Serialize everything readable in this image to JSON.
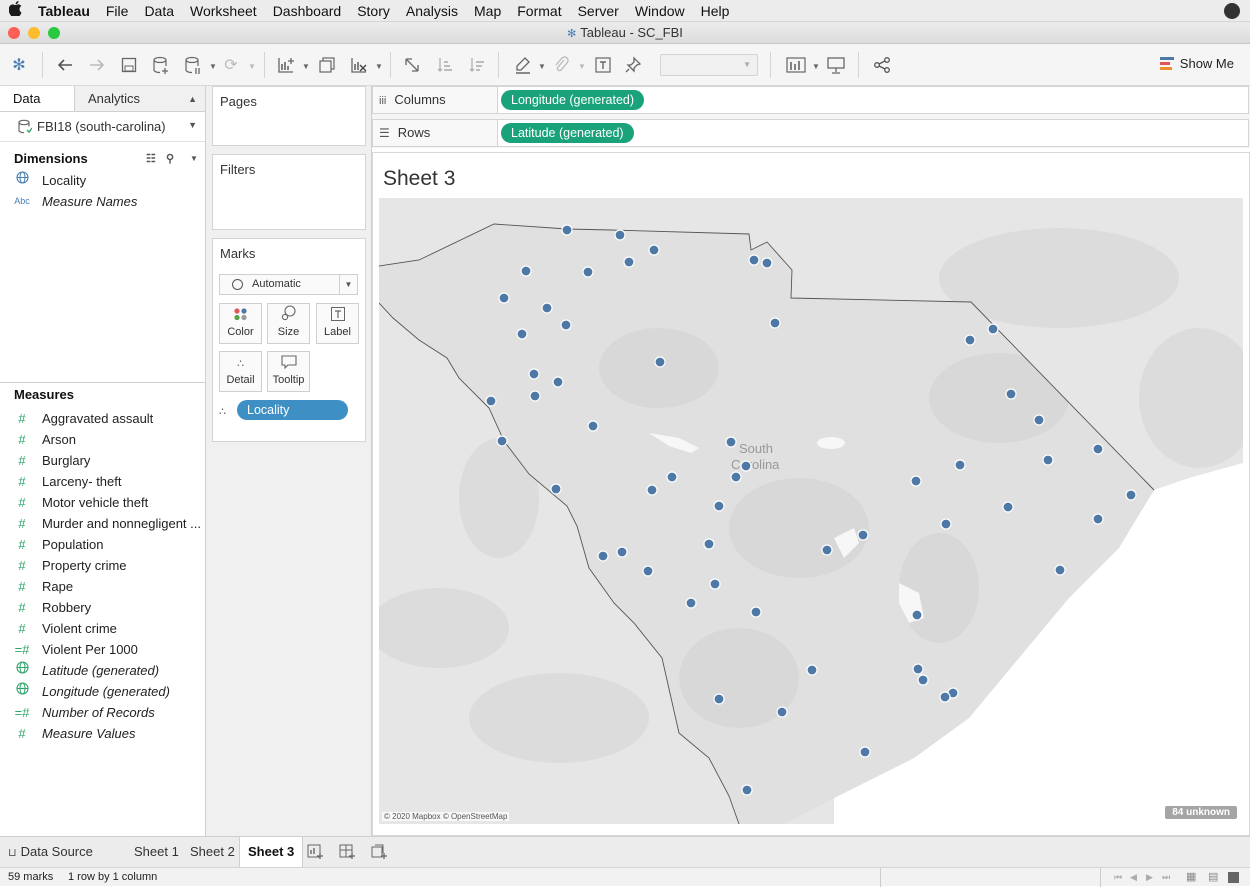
{
  "menubar": {
    "apple": "",
    "app": "Tableau",
    "items": [
      "File",
      "Data",
      "Worksheet",
      "Dashboard",
      "Story",
      "Analysis",
      "Map",
      "Format",
      "Server",
      "Window",
      "Help"
    ]
  },
  "window": {
    "title": "Tableau - SC_FBI"
  },
  "toolbar": {
    "show_me": "Show Me"
  },
  "left": {
    "tab_data": "Data",
    "tab_analytics": "Analytics",
    "datasource": "FBI18 (south-carolina)",
    "dimensions_label": "Dimensions",
    "dimensions": [
      {
        "name": "Locality",
        "icon": "globe-icon",
        "italic": false
      },
      {
        "name": "Measure Names",
        "icon": "abc-icon",
        "italic": true
      }
    ],
    "measures_label": "Measures",
    "measures": [
      {
        "name": "Aggravated assault",
        "icon": "#",
        "italic": false
      },
      {
        "name": "Arson",
        "icon": "#",
        "italic": false
      },
      {
        "name": "Burglary",
        "icon": "#",
        "italic": false
      },
      {
        "name": "Larceny- theft",
        "icon": "#",
        "italic": false
      },
      {
        "name": "Motor vehicle theft",
        "icon": "#",
        "italic": false
      },
      {
        "name": "Murder and nonnegligent ...",
        "icon": "#",
        "italic": false
      },
      {
        "name": "Population",
        "icon": "#",
        "italic": false
      },
      {
        "name": "Property crime",
        "icon": "#",
        "italic": false
      },
      {
        "name": "Rape",
        "icon": "#",
        "italic": false
      },
      {
        "name": "Robbery",
        "icon": "#",
        "italic": false
      },
      {
        "name": "Violent crime",
        "icon": "#",
        "italic": false
      },
      {
        "name": "Violent Per 1000",
        "icon": "=#",
        "italic": false
      },
      {
        "name": "Latitude (generated)",
        "icon": "globe",
        "italic": true
      },
      {
        "name": "Longitude (generated)",
        "icon": "globe",
        "italic": true
      },
      {
        "name": "Number of Records",
        "icon": "=#",
        "italic": true
      },
      {
        "name": "Measure Values",
        "icon": "#",
        "italic": true
      }
    ]
  },
  "shelves": {
    "pages": "Pages",
    "filters": "Filters",
    "marks": "Marks",
    "mark_type": "Automatic",
    "color": "Color",
    "size": "Size",
    "label": "Label",
    "detail": "Detail",
    "tooltip": "Tooltip",
    "detail_pill": "Locality"
  },
  "columns": {
    "label": "Columns",
    "pill": "Longitude (generated)"
  },
  "rows": {
    "label": "Rows",
    "pill": "Latitude (generated)"
  },
  "sheet": {
    "title": "Sheet 3",
    "map_label_line1": "South",
    "map_label_line2": "Carolina",
    "attribution": "© 2020 Mapbox © OpenStreetMap",
    "unknown": "84 unknown"
  },
  "bottom": {
    "datasource": "Data Source",
    "sheets": [
      "Sheet 1",
      "Sheet 2",
      "Sheet 3"
    ],
    "active": "Sheet 3"
  },
  "status": {
    "marks": "59 marks",
    "dims": "1 row by 1 column"
  },
  "colors": {
    "accent_pill": "#1aa37a",
    "detail_pill": "#3d8fc4",
    "mark": "#4e79a7"
  }
}
